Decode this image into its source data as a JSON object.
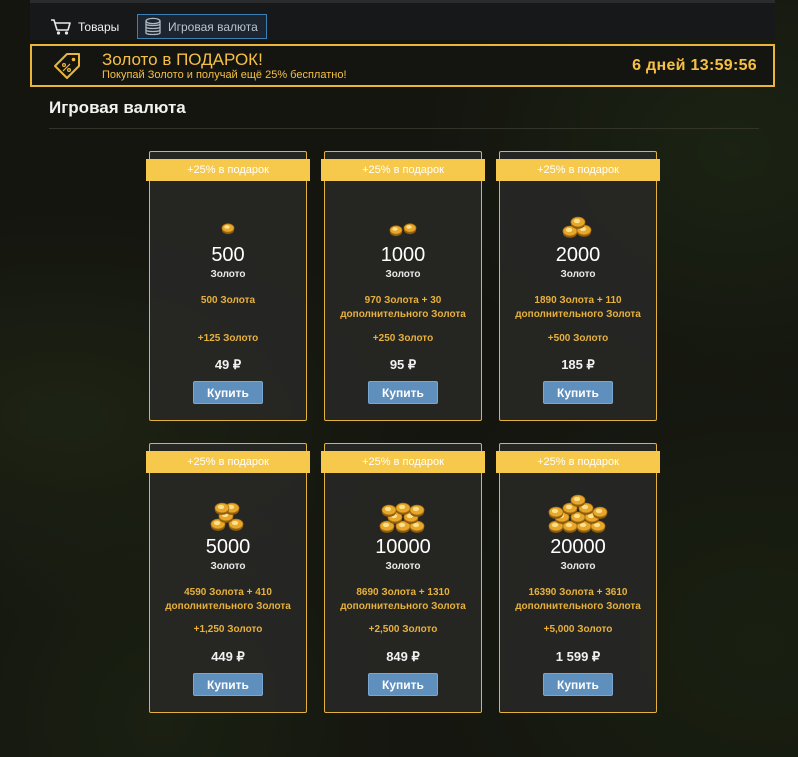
{
  "nav": {
    "goods_label": "Товары",
    "currency_label": "Игровая валюта"
  },
  "promo": {
    "title": "Золото в ПОДАРОК!",
    "subtitle": "Покупай Золото и получай ещё 25% бесплатно!",
    "timer": "6 дней 13:59:56"
  },
  "section_title": "Игровая валюта",
  "colors": {
    "accent_gold": "#f6c045",
    "ribbon": "#f6c94c",
    "buy_button": "#5f8fbd"
  },
  "packs": [
    {
      "ribbon": "+25% в подарок",
      "amount": "500",
      "amount_label": "Золото",
      "detail": "500 Золота",
      "bonus": "+125 Золото",
      "price": "49 ₽",
      "buy_label": "Купить",
      "coins": 1
    },
    {
      "ribbon": "+25% в подарок",
      "amount": "1000",
      "amount_label": "Золото",
      "detail": "970 Золота + 30 дополнительного Золота",
      "bonus": "+250 Золото",
      "price": "95 ₽",
      "buy_label": "Купить",
      "coins": 2
    },
    {
      "ribbon": "+25% в подарок",
      "amount": "2000",
      "amount_label": "Золото",
      "detail": "1890 Золота + 110 дополнительного Золота",
      "bonus": "+500 Золото",
      "price": "185 ₽",
      "buy_label": "Купить",
      "coins": 3
    },
    {
      "ribbon": "+25% в подарок",
      "amount": "5000",
      "amount_label": "Золото",
      "detail": "4590 Золота + 410 дополнительного Золота",
      "bonus": "+1,250 Золото",
      "price": "449 ₽",
      "buy_label": "Купить",
      "coins": 4
    },
    {
      "ribbon": "+25% в подарок",
      "amount": "10000",
      "amount_label": "Золото",
      "detail": "8690 Золота + 1310 дополнительного Золота",
      "bonus": "+2,500 Золото",
      "price": "849 ₽",
      "buy_label": "Купить",
      "coins": 5
    },
    {
      "ribbon": "+25% в подарок",
      "amount": "20000",
      "amount_label": "Золото",
      "detail": "16390 Золота + 3610 дополнительного Золота",
      "bonus": "+5,000 Золото",
      "price": "1 599 ₽",
      "buy_label": "Купить",
      "coins": 6
    }
  ]
}
